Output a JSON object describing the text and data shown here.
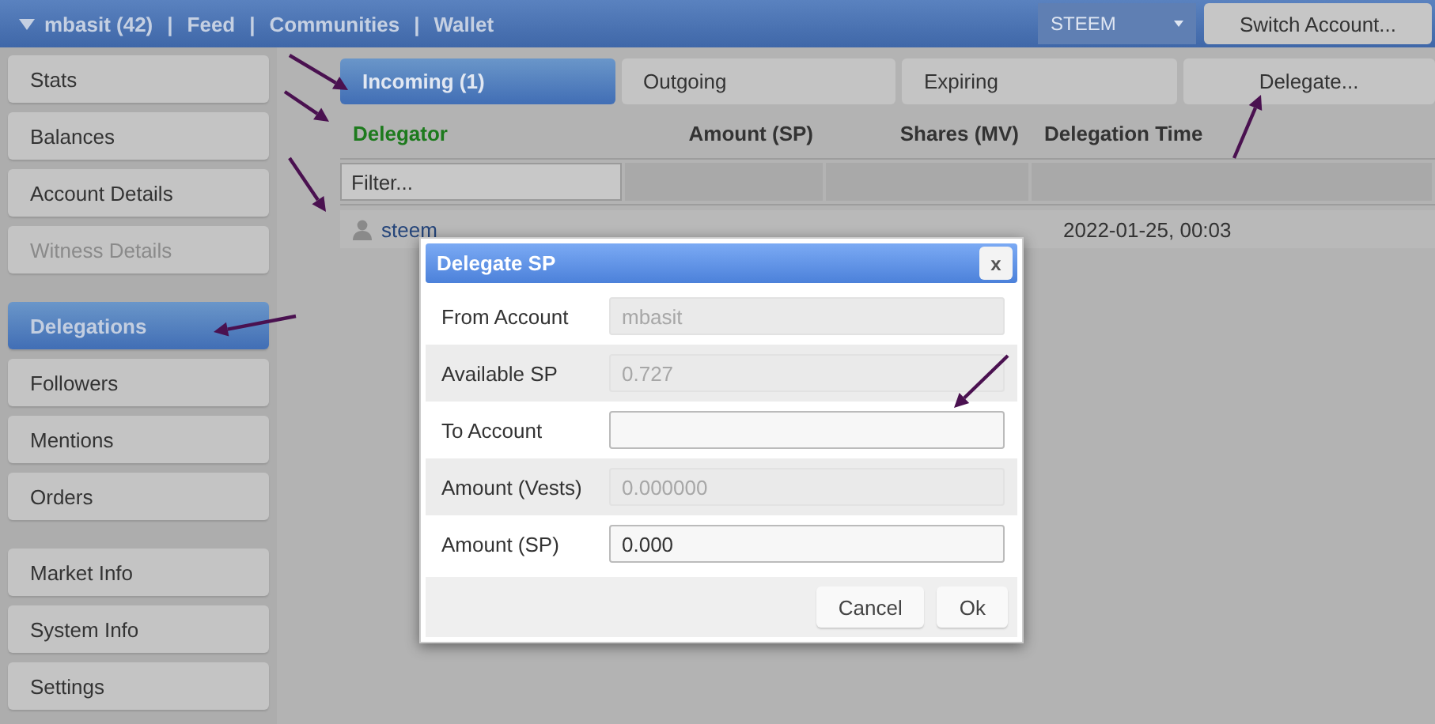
{
  "top_bar": {
    "account_menu": "mbasit (42)",
    "links": [
      {
        "label": "Feed"
      },
      {
        "label": "Communities"
      },
      {
        "label": "Wallet"
      }
    ],
    "separators": [
      "|",
      "|",
      "|"
    ],
    "chain_select": "STEEM",
    "switch_button": "Switch Account..."
  },
  "sidebar": {
    "groups": [
      [
        {
          "label": "Stats",
          "selected": false,
          "disabled": false
        },
        {
          "label": "Balances",
          "selected": false,
          "disabled": false
        },
        {
          "label": "Account Details",
          "selected": false,
          "disabled": false
        },
        {
          "label": "Witness Details",
          "selected": false,
          "disabled": true
        }
      ],
      [
        {
          "label": "Delegations",
          "selected": true,
          "disabled": false
        },
        {
          "label": "Followers",
          "selected": false,
          "disabled": false
        },
        {
          "label": "Mentions",
          "selected": false,
          "disabled": false
        },
        {
          "label": "Orders",
          "selected": false,
          "disabled": false
        }
      ],
      [
        {
          "label": "Market Info",
          "selected": false,
          "disabled": false
        },
        {
          "label": "System Info",
          "selected": false,
          "disabled": false
        },
        {
          "label": "Settings",
          "selected": false,
          "disabled": false
        }
      ]
    ]
  },
  "tabs": [
    {
      "label": "Incoming (1)",
      "selected": true
    },
    {
      "label": "Outgoing",
      "selected": false
    },
    {
      "label": "Expiring",
      "selected": false
    },
    {
      "label": "Delegate...",
      "selected": false
    }
  ],
  "table": {
    "columns": [
      {
        "label": "Delegator",
        "sorted": true
      },
      {
        "label": "Amount (SP)",
        "sorted": false
      },
      {
        "label": "Shares (MV)",
        "sorted": false
      },
      {
        "label": "Delegation Time",
        "sorted": false
      }
    ],
    "filter": {
      "placeholder": "Filter..."
    },
    "rows": [
      {
        "delegator": "steem",
        "time": "2022-01-25, 00:03"
      }
    ]
  },
  "dialog": {
    "title": "Delegate SP",
    "close": "x",
    "fields": [
      {
        "label": "From Account",
        "value": "mbasit",
        "disabled": true
      },
      {
        "label": "Available SP",
        "value": "0.727",
        "disabled": true
      },
      {
        "label": "To Account",
        "disabled": false
      },
      {
        "label": "Amount (Vests)",
        "value": "0.000000",
        "disabled": true
      },
      {
        "label": "Amount (SP)",
        "value": "0.000",
        "disabled": false
      }
    ],
    "buttons": [
      "Cancel",
      "Ok"
    ]
  }
}
